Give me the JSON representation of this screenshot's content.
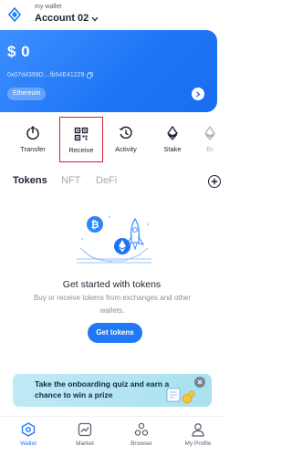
{
  "header": {
    "subtitle": "my wallet",
    "account_name": "Account 02"
  },
  "card": {
    "balance": "$ 0",
    "address": "0x07d4399D…fb54E41229",
    "chain": "Ethereum"
  },
  "actions": [
    {
      "label": "Transfer",
      "icon": "power-arrow-icon"
    },
    {
      "label": "Receive",
      "icon": "qr-code-icon"
    },
    {
      "label": "Activity",
      "icon": "clock-icon"
    },
    {
      "label": "Stake",
      "icon": "ethereum-diamond-icon"
    },
    {
      "label": "Br",
      "icon": "ethereum-diamond-icon"
    }
  ],
  "tabs": [
    {
      "label": "Tokens",
      "active": true
    },
    {
      "label": "NFT",
      "active": false
    },
    {
      "label": "DeFi",
      "active": false
    }
  ],
  "empty": {
    "title": "Get started with tokens",
    "description": "Buy or receive tokens from exchanges and other wallets.",
    "button": "Get tokens"
  },
  "promo": {
    "text": "Take the onboarding quiz and earn a chance to win a prize"
  },
  "bottom_nav": [
    {
      "label": "Wallet",
      "active": true
    },
    {
      "label": "Market",
      "active": false
    },
    {
      "label": "Browser",
      "active": false
    },
    {
      "label": "My Profile",
      "active": false
    }
  ],
  "colors": {
    "accent": "#2079f4",
    "highlight": "#d3212d",
    "promo_bg": "#bfe9f4"
  }
}
